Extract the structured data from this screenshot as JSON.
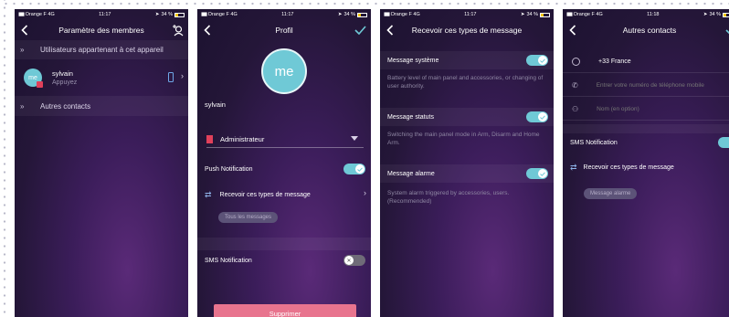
{
  "colors": {
    "accent": "#6fc9d6",
    "delete": "#e8748e",
    "badge": "#e0405a",
    "bg": "#2a1a44"
  },
  "status_bars": [
    {
      "carrier": "Orange F",
      "network": "4G",
      "time": "11:17",
      "battery": "34 %"
    },
    {
      "carrier": "Orange F",
      "network": "4G",
      "time": "11:17",
      "battery": "34 %"
    },
    {
      "carrier": "Orange F",
      "network": "4G",
      "time": "11:17",
      "battery": "34 %"
    },
    {
      "carrier": "Orange F",
      "network": "4G",
      "time": "11:18",
      "battery": "34 %"
    }
  ],
  "screen1": {
    "title": "Paramètre des membres",
    "section_device": "Utilisateurs appartenant à cet appareil",
    "user_avatar": "me",
    "user_name": "sylvain",
    "user_sub": "Appuyez",
    "section_contacts": "Autres contacts",
    "icons": {
      "back": "back-chevron-icon",
      "add": "add-user-icon",
      "collapse": "double-chevron-icon",
      "phone": "phone-device-icon"
    }
  },
  "screen2": {
    "title": "Profil",
    "avatar": "me",
    "name": "sylvain",
    "role": "Administrateur",
    "push_label": "Push Notification",
    "push_on": true,
    "receive_label": "Recevoir ces types de message",
    "receive_pill": "Tous les messages",
    "sms_label": "SMS Notification",
    "sms_on": false,
    "delete_label": "Supprimer",
    "icons": {
      "confirm": "check-icon",
      "role": "bookmark-icon",
      "receive": "message-types-icon",
      "dropdown": "dropdown-triangle-icon"
    }
  },
  "screen3": {
    "title": "Recevoir ces types de message",
    "items": [
      {
        "label": "Message système",
        "on": true,
        "desc": "Battery level of main panel and accessories, or changing of user authority."
      },
      {
        "label": "Message statuts",
        "on": true,
        "desc": "Switching the main panel mode in Arm, Disarm and Home Arm."
      },
      {
        "label": "Message alarme",
        "on": true,
        "desc": "System alarm triggered by accessories, users. (Recommended)"
      }
    ]
  },
  "screen4": {
    "title": "Autres contacts",
    "country": "+33 France",
    "phone_placeholder": "Entrer votre numéro de téléphone mobile",
    "name_placeholder": "Nom (en option)",
    "sms_label": "SMS Notification",
    "sms_on": true,
    "receive_label": "Recevoir ces types de message",
    "receive_pill": "Message alarme",
    "icons": {
      "country": "globe-icon",
      "phone": "phone-icon",
      "name": "person-icon",
      "receive": "message-types-icon",
      "confirm": "check-icon"
    }
  }
}
